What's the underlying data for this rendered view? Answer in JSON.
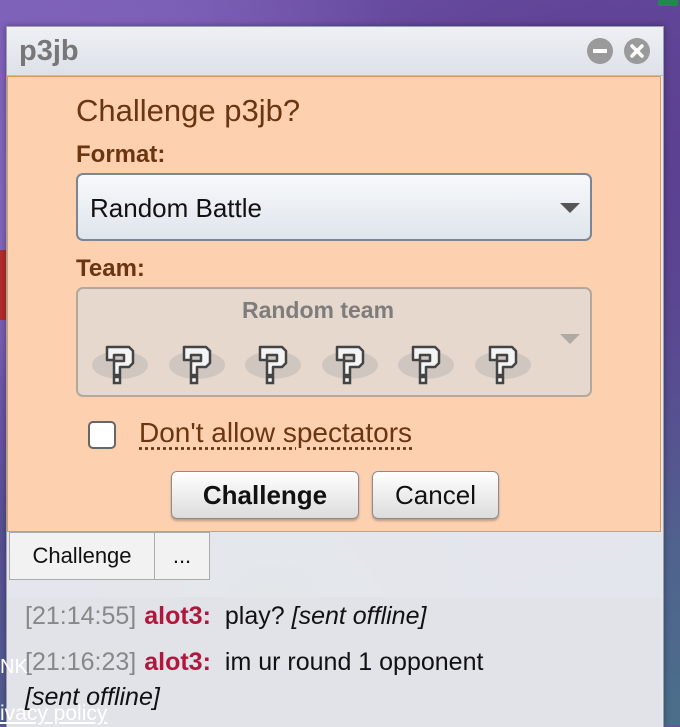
{
  "window": {
    "title": "p3jb"
  },
  "challenge": {
    "heading": "Challenge p3jb?",
    "format_label": "Format:",
    "format_value": "Random Battle",
    "team_label": "Team:",
    "team_value": "Random team",
    "team_slots": 6,
    "spectators_label": "Don't allow spectators",
    "spectators_checked": false,
    "challenge_button": "Challenge",
    "cancel_button": "Cancel"
  },
  "toolbar": {
    "challenge": "Challenge",
    "more": "..."
  },
  "log": [
    {
      "time": "[21:14:55]",
      "user": "alot3:",
      "message": "play?",
      "note": "[sent offline]"
    },
    {
      "time": "[21:16:23]",
      "user": "alot3:",
      "message": "im ur round 1 opponent",
      "note": "[sent offline]"
    }
  ],
  "background": {
    "link_fragment": "NK",
    "policy_fragment": "ivacy policy"
  },
  "colors": {
    "panel_bg": "#fdd0b0",
    "panel_text": "#6a3510",
    "username": "#b1173b",
    "timestamp": "#888888"
  }
}
